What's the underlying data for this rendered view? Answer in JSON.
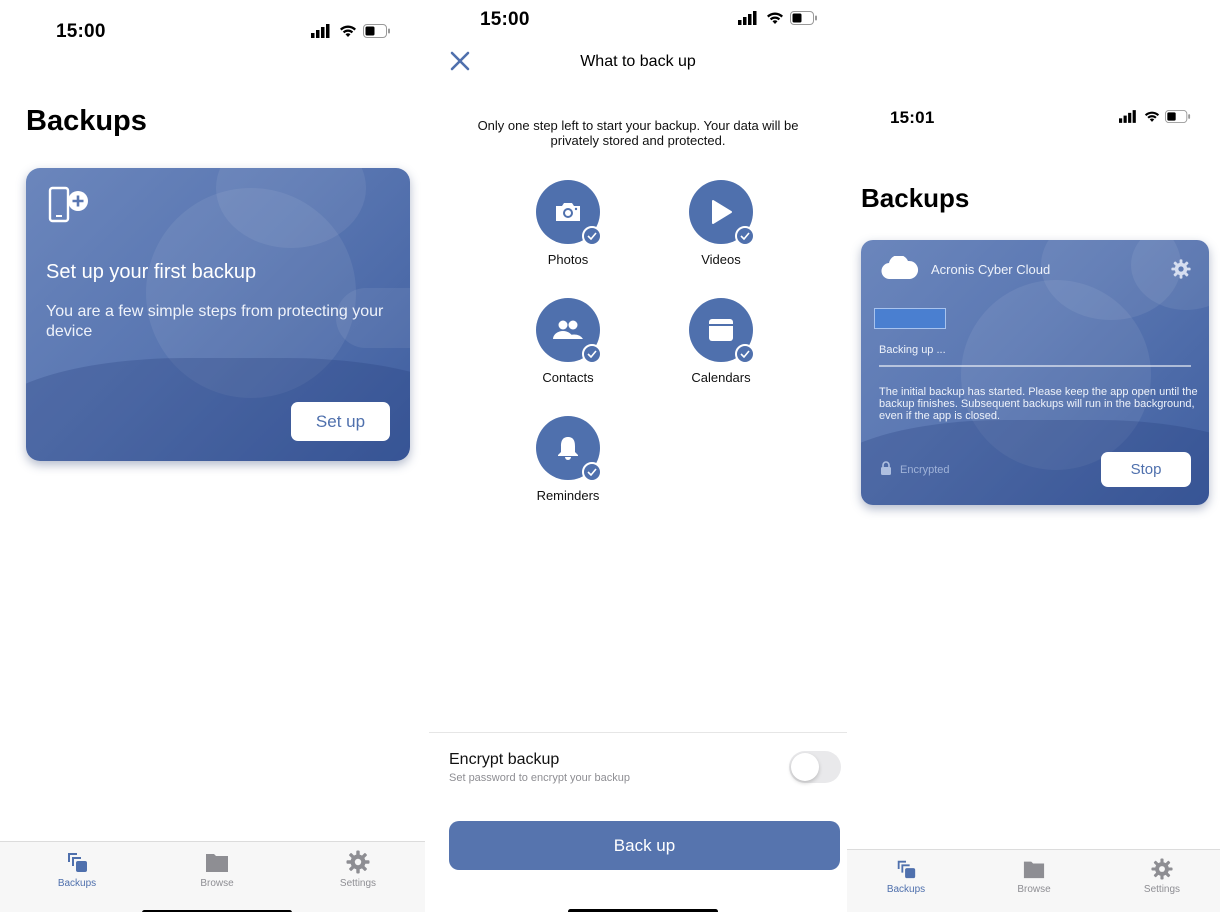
{
  "screen1": {
    "status_time": "15:00",
    "title": "Backups",
    "card": {
      "icon": "phone-add-icon",
      "title": "Set up your first backup",
      "text": "You are a few simple steps from protecting your device",
      "button_label": "Set up"
    },
    "tabs": [
      {
        "label": "Backups",
        "icon": "backups-icon",
        "active": true
      },
      {
        "label": "Browse",
        "icon": "folder-icon",
        "active": false
      },
      {
        "label": "Settings",
        "icon": "gear-icon",
        "active": false
      }
    ]
  },
  "screen2": {
    "status_time": "15:00",
    "header_title": "What to back up",
    "intro": "Only one step left to start your backup. Your data will be privately stored and protected.",
    "categories": [
      {
        "label": "Photos",
        "icon": "camera-icon",
        "checked": true
      },
      {
        "label": "Videos",
        "icon": "play-icon",
        "checked": true
      },
      {
        "label": "Contacts",
        "icon": "people-icon",
        "checked": true
      },
      {
        "label": "Calendars",
        "icon": "calendar-icon",
        "checked": true
      },
      {
        "label": "Reminders",
        "icon": "bell-icon",
        "checked": true
      }
    ],
    "encrypt": {
      "title": "Encrypt backup",
      "subtitle": "Set password to encrypt your backup",
      "enabled": false
    },
    "primary_button": "Back up"
  },
  "screen3": {
    "status_time": "15:01",
    "title": "Backups",
    "card": {
      "destination": "Acronis Cyber Cloud",
      "status": "Backing up ...",
      "message": "The initial backup has started. Please keep the app open until the backup finishes. Subsequent backups will run in the background, even if the app is closed.",
      "encrypted_label": "Encrypted",
      "button_label": "Stop"
    },
    "tabs": [
      {
        "label": "Backups",
        "icon": "backups-icon",
        "active": true
      },
      {
        "label": "Browse",
        "icon": "folder-icon",
        "active": false
      },
      {
        "label": "Settings",
        "icon": "gear-icon",
        "active": false
      }
    ]
  },
  "colors": {
    "accent": "#4f70ad",
    "card_gradient_start": "#6b86bc",
    "card_gradient_end": "#3f5e9f",
    "tab_inactive": "#8e8e93"
  }
}
